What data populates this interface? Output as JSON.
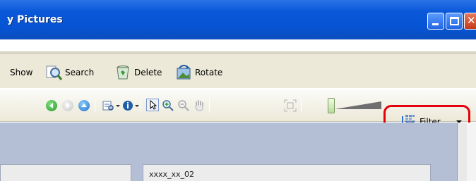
{
  "window": {
    "title": "y Pictures"
  },
  "toolbar": {
    "items": [
      {
        "label": "Show",
        "icon": "slideshow-icon"
      },
      {
        "label": "Search",
        "icon": "search-icon"
      },
      {
        "label": "Delete",
        "icon": "recycle-bin-icon"
      },
      {
        "label": "Rotate",
        "icon": "rotate-icon"
      }
    ]
  },
  "viewbar": {
    "filter_label": "Filter",
    "icons": [
      "back-icon",
      "forward-icon",
      "up-icon",
      "view-options-icon",
      "info-icon",
      "select-pointer-icon",
      "zoom-in-icon",
      "zoom-out-icon",
      "hand-pan-icon",
      "fit-to-window-icon",
      "zoom-slider",
      "filter-icon"
    ]
  },
  "content": {
    "items": [
      {
        "caption": ""
      },
      {
        "caption": "xxxx_xx_02"
      }
    ]
  },
  "colors": {
    "titlebar": "#0654d3",
    "highlight": "#e3000b",
    "content_bg": "#b4bfd6"
  }
}
